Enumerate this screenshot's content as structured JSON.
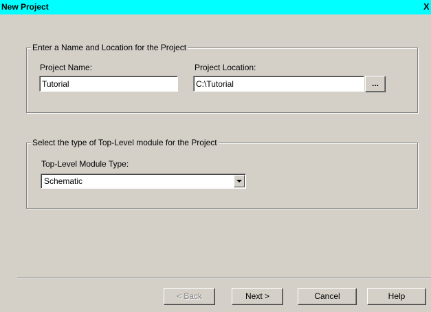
{
  "window": {
    "title": "New Project",
    "close_label": "X"
  },
  "name_location_group": {
    "legend": "Enter a Name and Location for the Project",
    "project_name_label": "Project Name:",
    "project_name_value": "Tutorial",
    "project_location_label": "Project Location:",
    "project_location_value": "C:\\Tutorial",
    "browse_label": "..."
  },
  "module_type_group": {
    "legend": "Select the type of Top-Level module for the Project",
    "module_type_label": "Top-Level Module Type:",
    "module_type_selected": "Schematic"
  },
  "buttons": {
    "back": "< Back",
    "next": "Next >",
    "cancel": "Cancel",
    "help": "Help"
  }
}
